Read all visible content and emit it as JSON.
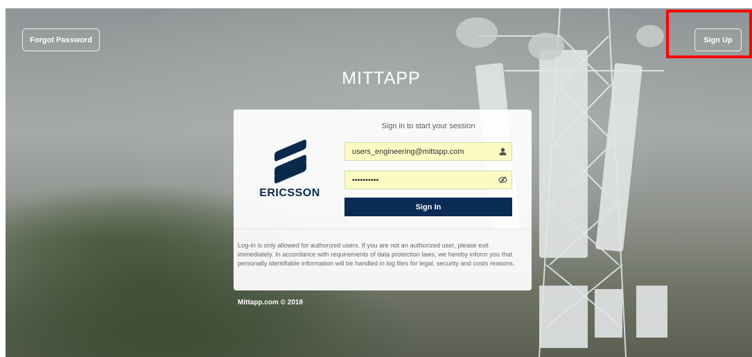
{
  "header": {
    "forgot_password_label": "Forgot Password",
    "sign_up_label": "Sign Up",
    "app_title": "MITTAPP"
  },
  "login": {
    "subtitle": "Sign in to start your session",
    "email_value": "users_engineering@mittapp.com",
    "password_value": "••••••••••",
    "sign_in_label": "Sign In",
    "email_icon": "user-icon",
    "password_icon": "eye-slash-icon"
  },
  "brand": {
    "logo_text": "ERICSSON",
    "logo_color": "#0a2a4d"
  },
  "notice": "Log-in is only allowed for authorized users. If you are not an authorized user, please exit immediately. In accordance with requirements of data protection laws, we hereby inform you that personally identifiable information will be handled in log files for legal, security and costs reasons.",
  "footer": {
    "copyright": "Mittapp.com © 2018"
  },
  "colors": {
    "primary_button": "#0a2b55",
    "autofill_field": "#fafcc4",
    "highlight_box": "#ff0000"
  }
}
